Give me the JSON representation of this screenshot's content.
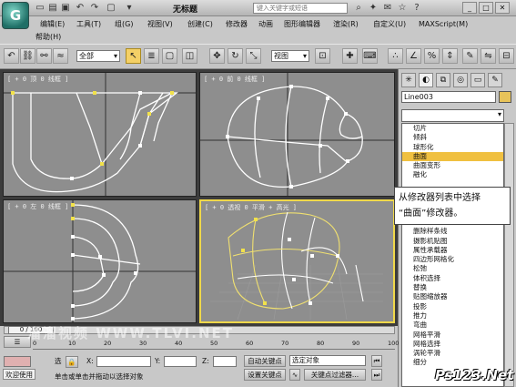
{
  "titlebar": {
    "logo": "G",
    "title": "无标题",
    "search_placeholder": "键入关键字或短语"
  },
  "menu": [
    "编辑(E)",
    "工具(T)",
    "组(G)",
    "视图(V)",
    "创建(C)",
    "修改器",
    "动画",
    "图形编辑器",
    "渲染(R)",
    "自定义(U)",
    "MAXScript(M)",
    "帮助(H)"
  ],
  "toolbar": {
    "selection_filter": "全部",
    "ref_coord": "视图"
  },
  "viewports": [
    {
      "label": "[ + 0 顶 0 线框 ]"
    },
    {
      "label": "[ + 0 前 0 线框 ]"
    },
    {
      "label": "[ + 0 左 0 线框 ]"
    },
    {
      "label": "[ + 0 透视 0 平滑 + 高光 ]"
    }
  ],
  "command_panel": {
    "object_name": "Line003",
    "object_color": "#e8c35a",
    "modifier_list": [
      "切片",
      "倾斜",
      "球形化",
      "曲面",
      "曲面变形",
      "融化",
      "",
      "",
      "",
      "",
      "",
      "删除样条线",
      "摄影机贴图",
      "属性承载器",
      "四边形网格化",
      "松弛",
      "体积选择",
      "替换",
      "贴图缩放器",
      "投影",
      "推力",
      "弯曲",
      "网格平滑",
      "网格选择",
      "涡轮平滑",
      "细分"
    ],
    "selected_index": 3
  },
  "callout": {
    "line1": "从修改器列表中选择",
    "line2": "“曲面”修改器。"
  },
  "timeline": {
    "frame": "0 / 100",
    "ticks": [
      "0",
      "10",
      "20",
      "30",
      "40",
      "50",
      "60",
      "70",
      "80",
      "90",
      "100"
    ]
  },
  "status": {
    "welcome": "欢迎使用",
    "select_label": "选",
    "x_label": "X:",
    "y_label": "Y:",
    "z_label": "Z:",
    "prompt": "单击或单击并拖动以选择对象",
    "auto_key": "自动关键点",
    "set_key": "设置关键点",
    "selected_object": "选定对象",
    "key_filter": "关键点过滤器..."
  },
  "watermark": "溜溜视频 WWW.TLVI.NET",
  "corner_logo": "Ps123.Net"
}
